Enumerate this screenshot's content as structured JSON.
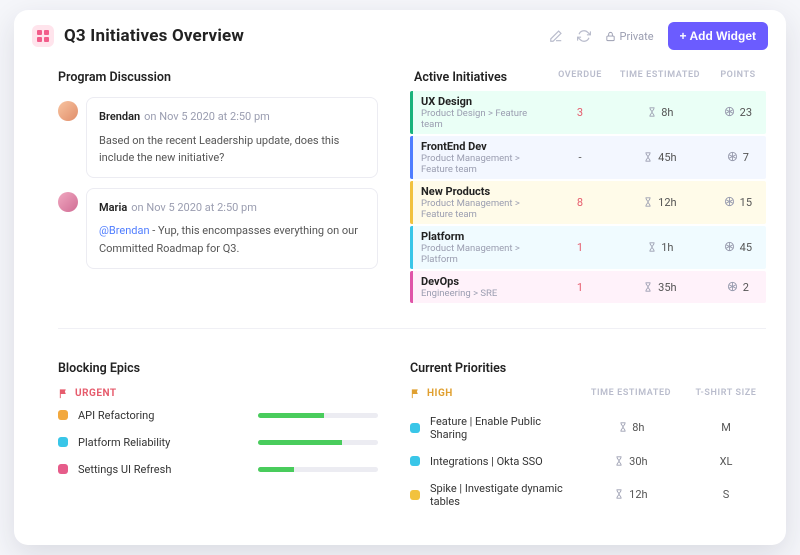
{
  "header": {
    "title": "Q3 Initiatives Overview",
    "privacy": "Private",
    "addWidget": "+ Add Widget"
  },
  "programDiscussion": {
    "title": "Program Discussion",
    "messages": [
      {
        "author": "Brendan",
        "when": "on Nov 5 2020 at 2:50 pm",
        "body": "Based on the recent Leadership update, does this include the new initiative?"
      },
      {
        "author": "Maria",
        "when": "on Nov 5 2020 at 2:50 pm",
        "mention": "@Brendan",
        "body": " - Yup, this encompasses everything on our Committed Roadmap for Q3."
      }
    ]
  },
  "activeInitiatives": {
    "title": "Active Initiatives",
    "columns": {
      "overdue": "OVERDUE",
      "time": "TIME ESTIMATED",
      "points": "POINTS"
    },
    "rows": [
      {
        "name": "UX Design",
        "path": "Product Design > Feature team",
        "overdue": "3",
        "time": "8h",
        "points": "23",
        "color": "#19b37b",
        "odColor": "#e65c6d",
        "bg": "#eafff6"
      },
      {
        "name": "FrontEnd Dev",
        "path": "Product Management > Feature team",
        "overdue": "-",
        "time": "45h",
        "points": "7",
        "color": "#4f7dff",
        "odColor": "#555",
        "bg": "#f3f7ff"
      },
      {
        "name": "New Products",
        "path": "Product Management > Feature team",
        "overdue": "8",
        "time": "12h",
        "points": "15",
        "color": "#f2c23e",
        "odColor": "#e65c6d",
        "bg": "#fffbe9"
      },
      {
        "name": "Platform",
        "path": "Product Management > Platform",
        "overdue": "1",
        "time": "1h",
        "points": "45",
        "color": "#39c6e8",
        "odColor": "#e65c6d",
        "bg": "#f0fbff"
      },
      {
        "name": "DevOps",
        "path": "Engineering > SRE",
        "overdue": "1",
        "time": "35h",
        "points": "2",
        "color": "#e055a8",
        "odColor": "#e65c6d",
        "bg": "#fff2fa"
      }
    ]
  },
  "blockingEpics": {
    "title": "Blocking Epics",
    "flag": "URGENT",
    "rows": [
      {
        "name": "API Refactoring",
        "color": "#f2a83e",
        "pct": 55
      },
      {
        "name": "Platform Reliability",
        "color": "#39c6e8",
        "pct": 70
      },
      {
        "name": "Settings UI Refresh",
        "color": "#e65c8a",
        "pct": 30
      }
    ]
  },
  "currentPriorities": {
    "title": "Current Priorities",
    "flag": "HIGH",
    "columns": {
      "time": "TIME ESTIMATED",
      "tshirt": "T-SHIRT SIZE"
    },
    "rows": [
      {
        "name": "Feature | Enable Public Sharing",
        "color": "#39c6e8",
        "time": "8h",
        "tshirt": "M"
      },
      {
        "name": "Integrations | Okta SSO",
        "color": "#39c6e8",
        "time": "30h",
        "tshirt": "XL"
      },
      {
        "name": "Spike | Investigate dynamic tables",
        "color": "#f2c23e",
        "time": "12h",
        "tshirt": "S"
      }
    ]
  }
}
